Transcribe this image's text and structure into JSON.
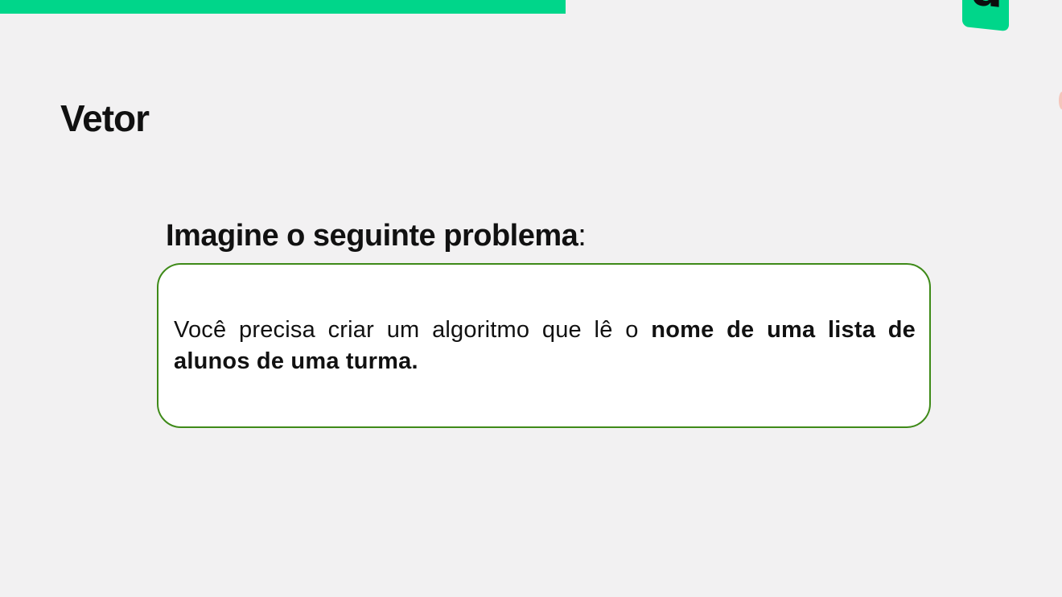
{
  "slide": {
    "title": "Vetor",
    "heading": {
      "text": "Imagine o seguinte problema",
      "suffix": ":"
    },
    "problem": {
      "text_regular": "Você precisa criar um algoritmo que lê o ",
      "text_bold": "nome de uma lista de alunos de uma turma."
    }
  },
  "branding": {
    "logo_letter": "a",
    "accent_color": "#00d68a",
    "box_border_color": "#3e8a18"
  }
}
